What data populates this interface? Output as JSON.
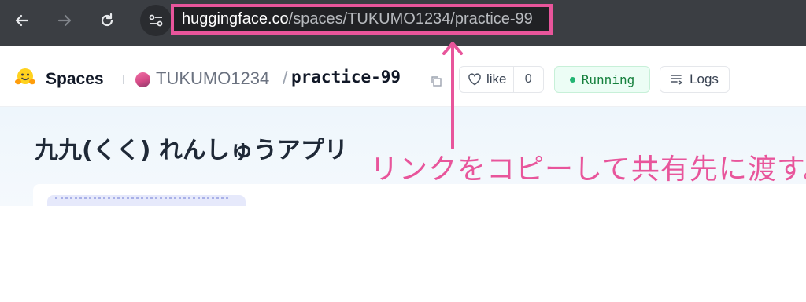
{
  "browser": {
    "url_host": "huggingface.co",
    "url_path": "/spaces/TUKUMO1234/practice-99",
    "icons": [
      "back-arrow-icon",
      "forward-arrow-icon",
      "reload-icon",
      "site-info-icon"
    ]
  },
  "header": {
    "brand_label": "Spaces",
    "owner": "TUKUMO1234",
    "separator": "/",
    "repo_name": "practice-99",
    "like_label": "like",
    "like_count": "0",
    "status_label": "Running",
    "logs_label": "Logs"
  },
  "app": {
    "title": "九九(くく) れんしゅうアプリ"
  },
  "annotation": {
    "text": "リンクをコピーして共有先に渡す。",
    "color": "#e8559b"
  },
  "colors": {
    "toolbar_bg": "#3b3e43",
    "highlight": "#e8559b",
    "status_green": "#15803d"
  }
}
